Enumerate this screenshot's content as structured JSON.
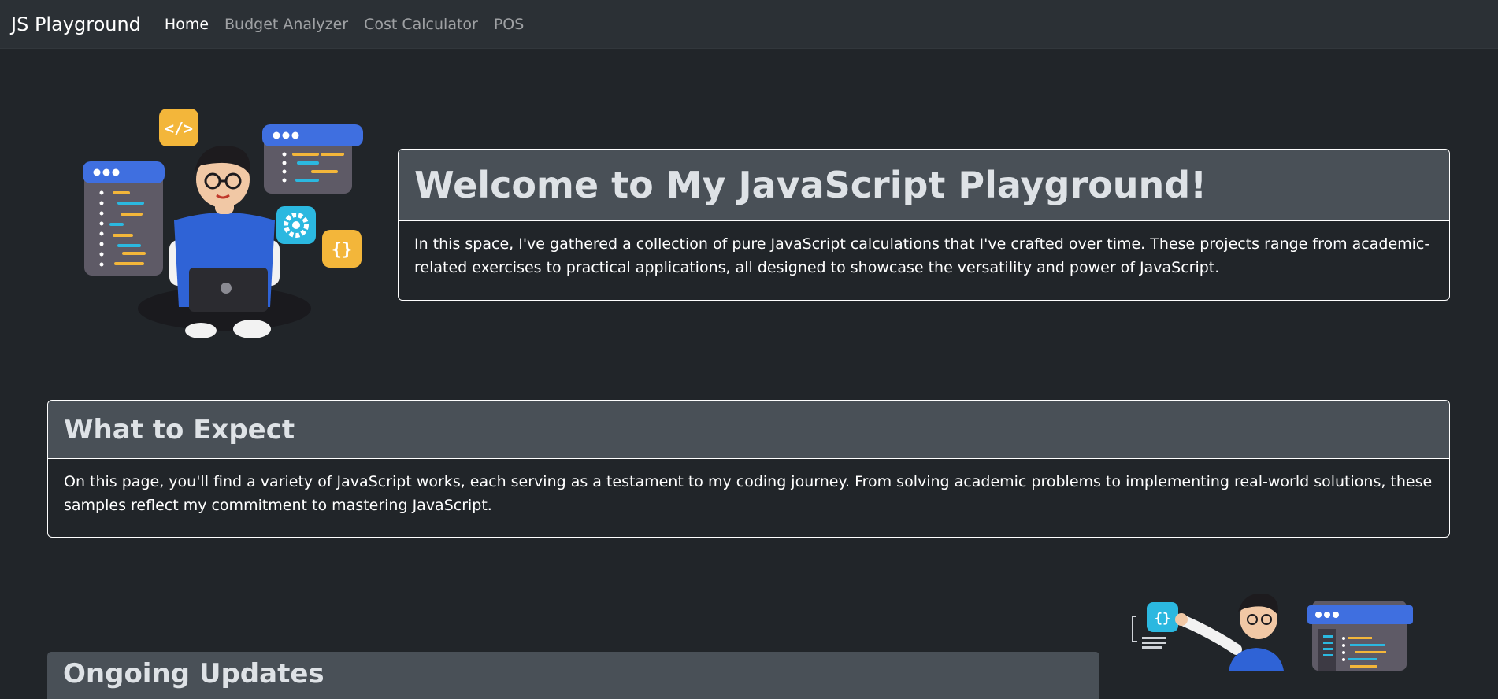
{
  "navbar": {
    "brand": "JS Playground",
    "links": [
      {
        "label": "Home",
        "active": true
      },
      {
        "label": "Budget Analyzer",
        "active": false
      },
      {
        "label": "Cost Calculator",
        "active": false
      },
      {
        "label": "POS",
        "active": false
      }
    ]
  },
  "hero": {
    "title": "Welcome to My JavaScript Playground!",
    "text": "In this space, I've gathered a collection of pure JavaScript calculations that I've crafted over time. These projects range from academic-related exercises to practical applications, all designed to showcase the versatility and power of JavaScript.",
    "illustration_icons": [
      "code-tag-icon",
      "gear-icon",
      "curly-braces-icon",
      "code-window-icon",
      "laptop-icon"
    ]
  },
  "expect": {
    "title": "What to Expect",
    "text": "On this page, you'll find a variety of JavaScript works, each serving as a testament to my coding journey. From solving academic problems to implementing real-world solutions, these samples reflect my commitment to mastering JavaScript."
  },
  "updates": {
    "title": "Ongoing Updates"
  },
  "colors": {
    "background": "#212529",
    "navbar": "#2b3035",
    "card_header": "#495057",
    "window_blue": "#3f6fe0",
    "accent_yellow": "#f3b63a",
    "accent_cyan": "#2bb8e0"
  }
}
